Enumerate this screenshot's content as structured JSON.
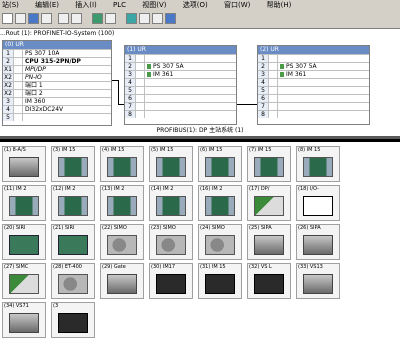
{
  "menubar": {
    "items": [
      "站(S)",
      "编辑(E)",
      "插入(I)",
      "PLC",
      "视图(V)",
      "选项(O)",
      "窗口(W)",
      "帮助(H)"
    ]
  },
  "station_title": "...Rout (1): PROFINET-IO-System (100)",
  "racks": [
    {
      "title": "(0) UR",
      "rows": [
        {
          "slot": "1",
          "name": "PS 307 10A"
        },
        {
          "slot": "2",
          "name": "CPU 315-2PN/DP"
        },
        {
          "slot": "X1",
          "name": "MPI/DP"
        },
        {
          "slot": "X2",
          "name": "PN-IO"
        },
        {
          "slot": "X2 P1",
          "name": "端口 1"
        },
        {
          "slot": "X2 P2",
          "name": "端口 2"
        },
        {
          "slot": "3",
          "name": "IM 360"
        },
        {
          "slot": "4",
          "name": "DI32xDC24V"
        },
        {
          "slot": "5",
          "name": ""
        }
      ]
    },
    {
      "title": "(1) UR",
      "rows": [
        {
          "slot": "1",
          "name": ""
        },
        {
          "slot": "2",
          "name": "PS 307 5A"
        },
        {
          "slot": "3",
          "name": "IM 361"
        },
        {
          "slot": "4",
          "name": ""
        },
        {
          "slot": "5",
          "name": ""
        },
        {
          "slot": "6",
          "name": ""
        },
        {
          "slot": "7",
          "name": ""
        },
        {
          "slot": "8",
          "name": ""
        },
        {
          "slot": "9",
          "name": ""
        }
      ]
    },
    {
      "title": "(2) UR",
      "rows": [
        {
          "slot": "1",
          "name": ""
        },
        {
          "slot": "2",
          "name": "PS 307 5A"
        },
        {
          "slot": "3",
          "name": "IM 361"
        },
        {
          "slot": "4",
          "name": ""
        },
        {
          "slot": "5",
          "name": ""
        },
        {
          "slot": "6",
          "name": ""
        },
        {
          "slot": "7",
          "name": ""
        },
        {
          "slot": "8",
          "name": ""
        },
        {
          "slot": "9",
          "name": ""
        }
      ]
    }
  ],
  "network_title": "PROFIBUS(1): DP 主站系统 (1)",
  "devices": [
    {
      "label": "(1) 8-A/S",
      "img": "photo"
    },
    {
      "label": "(3) IM 15",
      "img": "module"
    },
    {
      "label": "(4) IM 15",
      "img": "module"
    },
    {
      "label": "(5) IM 15",
      "img": "module"
    },
    {
      "label": "(6) IM 15",
      "img": "module"
    },
    {
      "label": "(7) IM 15",
      "img": "module"
    },
    {
      "label": "(8) IM 15",
      "img": "module"
    },
    {
      "label": "(11) IM 2",
      "img": "module"
    },
    {
      "label": "(12) IM 2",
      "img": "module"
    },
    {
      "label": "(13) IM 2",
      "img": "module"
    },
    {
      "label": "(14) IM 2",
      "img": "module"
    },
    {
      "label": "(16) IM 2",
      "img": "module"
    },
    {
      "label": "(17) DP/",
      "img": "panel"
    },
    {
      "label": "(18) I/O-",
      "img": "dp"
    },
    {
      "label": "(20) SIRI",
      "img": "green"
    },
    {
      "label": "(21) SIRI",
      "img": "green"
    },
    {
      "label": "(22) SIMO",
      "img": "motor"
    },
    {
      "label": "(23) SIMO",
      "img": "motor"
    },
    {
      "label": "(24) SIMO",
      "img": "motor"
    },
    {
      "label": "(25) SIPA",
      "img": "photo"
    },
    {
      "label": "(26) SIPA",
      "img": "photo"
    },
    {
      "label": "(27) SIMC",
      "img": "panel"
    },
    {
      "label": "(28) ET-400",
      "img": "motor"
    },
    {
      "label": "(29) Gate",
      "img": "photo"
    },
    {
      "label": "(30) IM17",
      "img": "dark"
    },
    {
      "label": "(31) IM 15",
      "img": "dark"
    },
    {
      "label": "(32) VS L",
      "img": "dark"
    },
    {
      "label": "(33) VS13",
      "img": "photo"
    },
    {
      "label": "(34) VS71",
      "img": "photo"
    },
    {
      "label": "(3",
      "img": "dark"
    }
  ]
}
